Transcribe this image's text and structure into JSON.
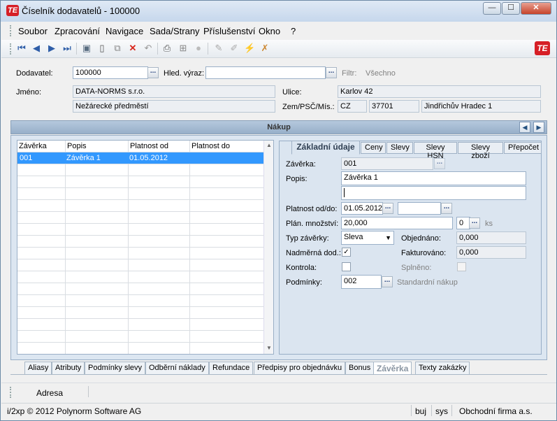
{
  "window": {
    "title": "Číselník dodavatelů - 100000",
    "app_icon": "TE"
  },
  "menu": [
    "Soubor",
    "Zpracování",
    "Navigace",
    "Sada/Strany",
    "Příslušenství",
    "Okno",
    "?"
  ],
  "toolbar": {
    "icons": [
      "first-record-icon",
      "prev-record-icon",
      "next-record-icon",
      "last-record-icon",
      "save-icon",
      "new-icon",
      "copy-icon",
      "delete-icon",
      "undo-icon",
      "print-icon",
      "tree-icon",
      "stop-icon",
      "edit-icon",
      "edit2-icon",
      "wand-icon",
      "clear-icon"
    ]
  },
  "header": {
    "dodavatel_label": "Dodavatel:",
    "dodavatel_value": "100000",
    "hled_label": "Hled. výraz:",
    "hled_value": "",
    "filtr_label": "Filtr:",
    "filtr_value": "Všechno",
    "jmeno_label": "Jméno:",
    "jmeno_value": "DATA-NORMS s.r.o.",
    "jmeno2_value": "Nežárecké předměstí",
    "ulice_label": "Ulice:",
    "ulice_value": "Karlov 42",
    "zem_label": "Zem/PSČ/Mís.:",
    "zem_value": "CZ",
    "psc_value": "37701",
    "mesto_value": "Jindřichův Hradec 1"
  },
  "section": {
    "title": "Nákup"
  },
  "grid": {
    "columns": [
      "Závěrka",
      "Popis",
      "Platnost od",
      "Platnost do"
    ],
    "rows": [
      [
        "001",
        "Závěrka 1",
        "01.05.2012",
        ""
      ]
    ]
  },
  "tabs": [
    "Základní údaje",
    "Ceny",
    "Slevy",
    "Slevy HSN",
    "Slevy zboží",
    "Přepočet"
  ],
  "form": {
    "zaverka_label": "Závěrka:",
    "zaverka_value": "001",
    "popis_label": "Popis:",
    "popis_value": "Závěrka 1",
    "popis2_value": "",
    "platnost_label": "Platnost od/do:",
    "platnost_od": "01.05.2012",
    "platnost_do": "",
    "plan_label": "Plán. množství:",
    "plan_value": "20,000",
    "plan_count": "0",
    "plan_unit": "ks",
    "typ_label": "Typ závěrky:",
    "typ_value": "Sleva",
    "objednano_label": "Objednáno:",
    "objednano_value": "0,000",
    "nadmerna_label": "Nadměrná dod.:",
    "nadmerna_checked": "✓",
    "fakturovano_label": "Fakturováno:",
    "fakturovano_value": "0,000",
    "kontrola_label": "Kontrola:",
    "splneno_label": "Splněno:",
    "podminky_label": "Podmínky:",
    "podminky_value": "002",
    "podminky_desc": "Standardní nákup"
  },
  "bottom_tabs": [
    "Aliasy",
    "Atributy",
    "Podmínky slevy",
    "Odběrní náklady",
    "Refundace",
    "Předpisy pro objednávku",
    "Bonus",
    "Závěrka",
    "Texty zakázky"
  ],
  "adresa": "Adresa",
  "status": {
    "copyright": "i/2xp © 2012 Polynorm Software AG",
    "user": "buj",
    "sys": "sys",
    "firm": "Obchodní firma a.s."
  }
}
